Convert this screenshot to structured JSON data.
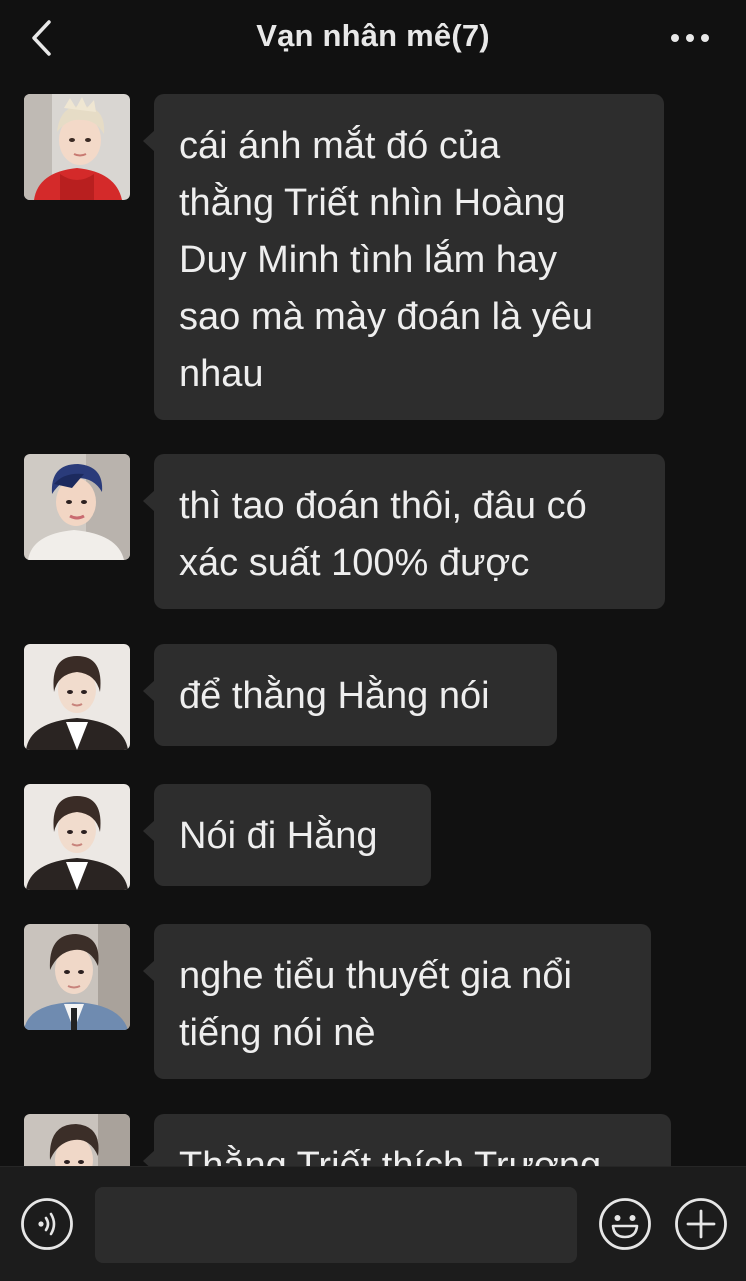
{
  "header": {
    "title": "Vạn nhân mê(7)",
    "back_icon": "chevron-left-icon",
    "more_icon": "ellipsis-icon"
  },
  "messages": [
    {
      "avatar": "avatar-red-hoodie",
      "text": "cái ánh mắt đó của\nthằng Triết nhìn Hoàng\nDuy Minh tình lắm hay\nsao mà mày đoán là yêu\nnhau"
    },
    {
      "avatar": "avatar-blue-hair",
      "text": "thì tao đoán thôi, đâu có\nxác suất 100% được"
    },
    {
      "avatar": "avatar-dark-jacket",
      "text": "để thằng Hằng nói"
    },
    {
      "avatar": "avatar-dark-jacket",
      "text": "Nói đi Hằng"
    },
    {
      "avatar": "avatar-denim-jacket",
      "text": "nghe tiểu thuyết gia nổi\ntiếng nói nè"
    },
    {
      "avatar": "avatar-denim-jacket",
      "text": "Thằng Triết thích Trương"
    }
  ],
  "input": {
    "placeholder": "",
    "value": "",
    "voice_icon": "voice-icon",
    "emoji_icon": "emoji-icon",
    "add_icon": "plus-icon"
  },
  "colors": {
    "background": "#111111",
    "bubble": "#2d2d2d",
    "text": "#eeeeee",
    "input_bar": "#1c1c1c"
  }
}
